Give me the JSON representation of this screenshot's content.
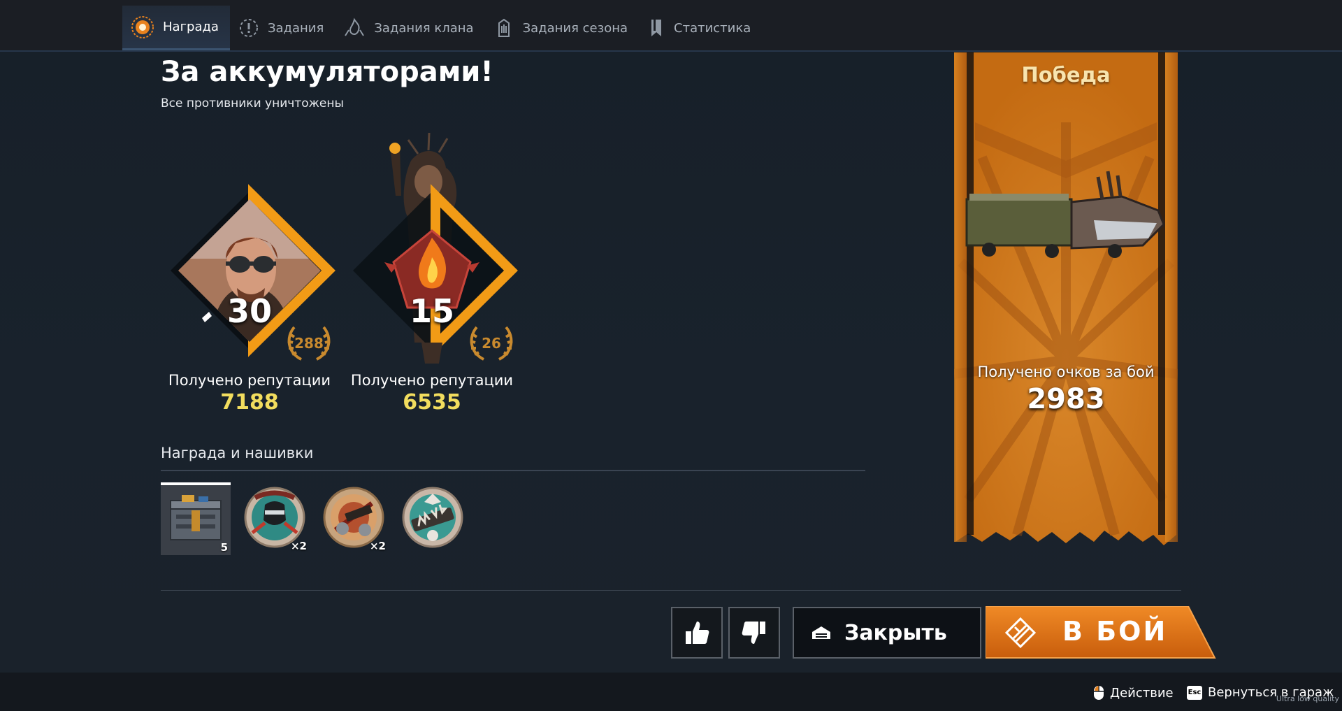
{
  "tabs": [
    {
      "label": "Награда",
      "icon": "reward-medal-icon",
      "active": true
    },
    {
      "label": "Задания",
      "icon": "mission-alert-icon",
      "active": false
    },
    {
      "label": "Задания клана",
      "icon": "clan-flame-icon",
      "active": false
    },
    {
      "label": "Задания сезона",
      "icon": "season-tower-icon",
      "active": false
    },
    {
      "label": "Статистика",
      "icon": "bookmark-icon",
      "active": false
    }
  ],
  "mission": {
    "title": "За аккумуляторами!",
    "subtitle": "Все противники уничтожены"
  },
  "reputation": [
    {
      "level": "30",
      "rank": "288",
      "label": "Получено репутации",
      "value": "7188",
      "portrait": "goggles-survivor-portrait"
    },
    {
      "level": "15",
      "rank": "26",
      "label": "Получено репутации",
      "value": "6535",
      "portrait": "fire-faction-emblem"
    }
  ],
  "rewards": {
    "title": "Награда и нашивки",
    "items": [
      {
        "name": "battery-crate",
        "count": "5",
        "selected": true
      },
      {
        "name": "backstab-patch",
        "count": "×2",
        "selected": false
      },
      {
        "name": "kill-joy-patch",
        "count": "×2",
        "selected": false
      },
      {
        "name": "mvp-patch",
        "count": "",
        "selected": false
      }
    ]
  },
  "result": {
    "title": "Победа",
    "score_label": "Получено очков за бой",
    "score": "2983"
  },
  "actions": {
    "like_icon": "thumbs-up-icon",
    "dislike_icon": "thumbs-down-icon",
    "close_label": "Закрыть",
    "battle_label": "В БОЙ"
  },
  "footer": {
    "action_hint": "Действие",
    "esc_key": "Esc",
    "garage_hint": "Вернуться в гараж",
    "quality": "Ultra low quality"
  },
  "colors": {
    "accent_orange": "#e8821e",
    "reputation_yellow": "#f2dd5e",
    "banner_title": "#f8e4ae"
  }
}
